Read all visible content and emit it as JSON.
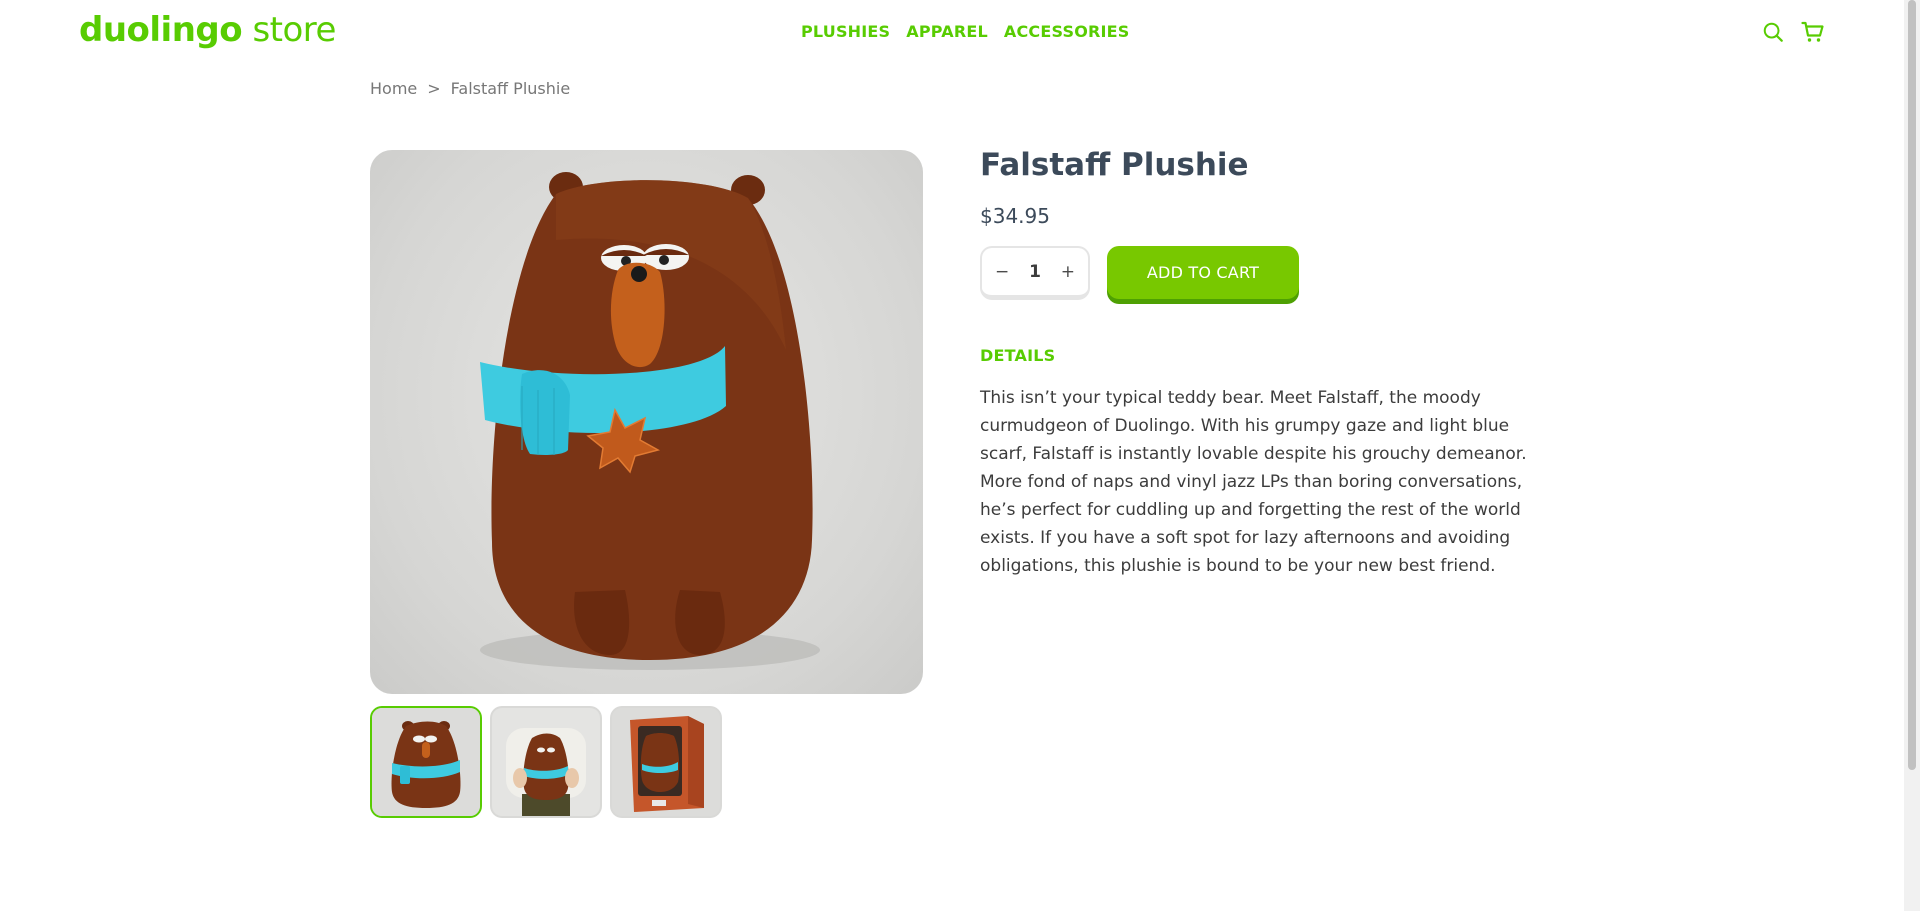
{
  "header": {
    "logo_brand": "duolingo",
    "logo_suffix": "store",
    "nav": [
      "PLUSHIES",
      "APPAREL",
      "ACCESSORIES"
    ],
    "icons": [
      "search-icon",
      "cart-icon"
    ]
  },
  "breadcrumb": {
    "home": "Home",
    "separator": ">",
    "current": "Falstaff Plushie"
  },
  "product": {
    "title": "Falstaff Plushie",
    "price": "$34.95",
    "quantity": {
      "minus": "−",
      "value": "1",
      "plus": "+"
    },
    "add_to_cart": "ADD TO CART",
    "details_heading": "DETAILS",
    "description": "This isn’t your typical teddy bear. Meet Falstaff, the moody curmudgeon of Duolingo. With his grumpy gaze and light blue scarf, Falstaff is instantly lovable despite his grouchy demeanor. More fond of naps and vinyl jazz LPs than boring conversations, he’s perfect for cuddling up and forgetting the rest of the world exists. If you have a soft spot for lazy afternoons and avoiding obligations, this plushie is bound to be your new best friend.",
    "selected_thumbnail": 1
  },
  "colors": {
    "brand_green": "#58cc02",
    "button_green": "#78c800",
    "bear_brown": "#7a3415",
    "scarf_blue": "#3ecbe0"
  }
}
